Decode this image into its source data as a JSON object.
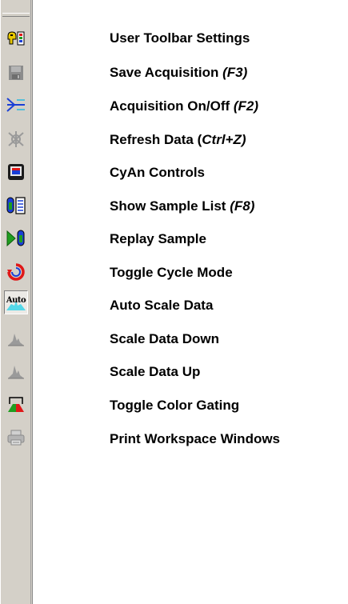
{
  "toolbar": {
    "items": [
      {
        "icon": "user-toolbar-settings-icon",
        "label": "User Toolbar Settings",
        "shortcut": ""
      },
      {
        "icon": "save-acquisition-icon",
        "label": "Save Acquisition ",
        "shortcut": "(F3)"
      },
      {
        "icon": "acquisition-toggle-icon",
        "label": "Acquisition On/Off ",
        "shortcut": "(F2)"
      },
      {
        "icon": "refresh-data-icon",
        "label": "Refresh Data (",
        "shortcut": "Ctrl+Z)"
      },
      {
        "icon": "cyan-controls-icon",
        "label": "CyAn Controls",
        "shortcut": ""
      },
      {
        "icon": "sample-list-icon",
        "label": "Show Sample List ",
        "shortcut": "(F8)"
      },
      {
        "icon": "replay-sample-icon",
        "label": "Replay Sample",
        "shortcut": ""
      },
      {
        "icon": "cycle-mode-icon",
        "label": "Toggle Cycle Mode",
        "shortcut": ""
      },
      {
        "icon": "auto-scale-icon",
        "label": "Auto Scale Data",
        "shortcut": "",
        "icon_text": "Auto",
        "pressed": true
      },
      {
        "icon": "scale-down-icon",
        "label": "Scale Data Down",
        "shortcut": ""
      },
      {
        "icon": "scale-up-icon",
        "label": "Scale Data Up",
        "shortcut": ""
      },
      {
        "icon": "color-gating-icon",
        "label": "Toggle Color Gating",
        "shortcut": ""
      },
      {
        "icon": "print-workspace-icon",
        "label": "Print Workspace Windows",
        "shortcut": ""
      }
    ]
  },
  "colors": {
    "toolbar_bg": "#d4d0c8",
    "disabled_gray": "#9a9a9a",
    "accent_blue": "#1a3fd6",
    "accent_green": "#1f9e1f",
    "accent_red": "#e01818"
  }
}
